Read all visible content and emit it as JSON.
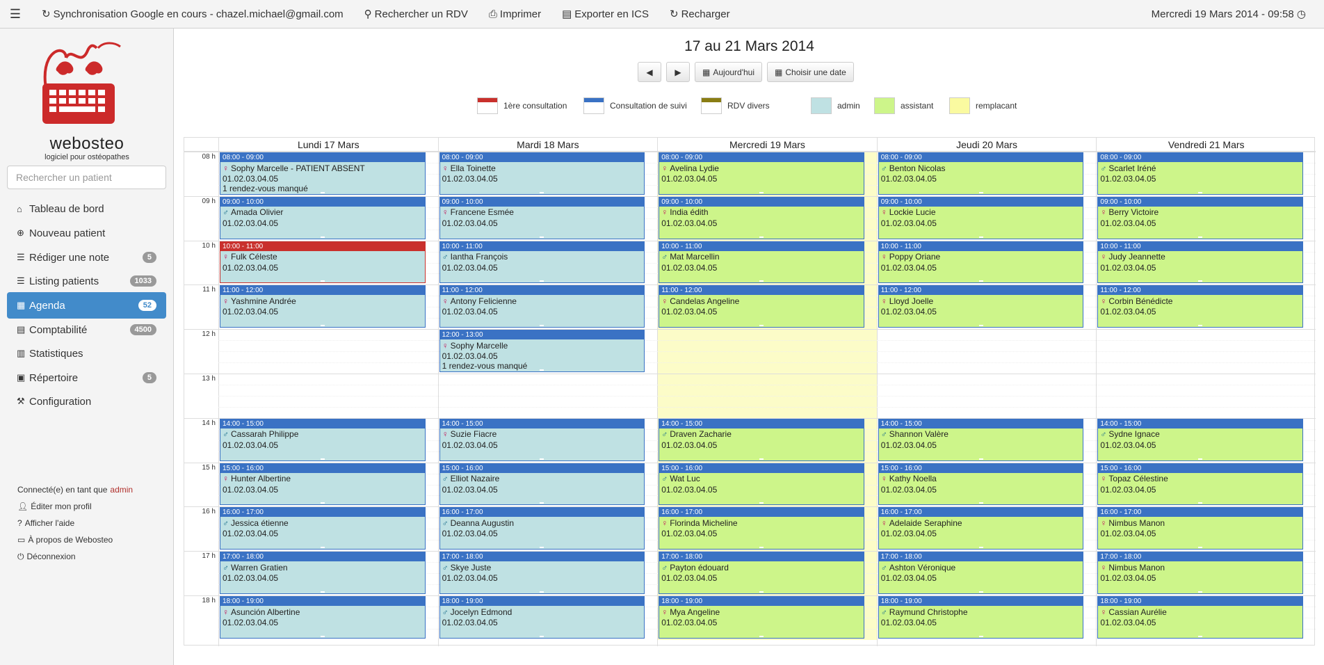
{
  "topbar": {
    "sync_text": "Synchronisation Google en cours - chazel.michael@gmail.com",
    "search_rdv": "Rechercher un RDV",
    "print": "Imprimer",
    "export": "Exporter en ICS",
    "reload": "Recharger",
    "datetime": "Mercredi 19 Mars 2014 - 09:58"
  },
  "logo": {
    "brand": "webosteo",
    "tagline": "logiciel pour ostéopathes"
  },
  "sidebar": {
    "search_placeholder": "Rechercher un patient",
    "items": [
      {
        "label": "Tableau de bord",
        "icon": "home-icon",
        "badge": ""
      },
      {
        "label": "Nouveau patient",
        "icon": "plus-circle-icon",
        "badge": ""
      },
      {
        "label": "Rédiger une note",
        "icon": "list-icon",
        "badge": "5"
      },
      {
        "label": "Listing patients",
        "icon": "list-icon",
        "badge": "1033"
      },
      {
        "label": "Agenda",
        "icon": "calendar-icon",
        "badge": "52",
        "active": true
      },
      {
        "label": "Comptabilité",
        "icon": "calculator-icon",
        "badge": "4500"
      },
      {
        "label": "Statistiques",
        "icon": "bar-chart-icon",
        "badge": ""
      },
      {
        "label": "Répertoire",
        "icon": "book-icon",
        "badge": "5"
      },
      {
        "label": "Configuration",
        "icon": "wrench-icon",
        "badge": ""
      }
    ],
    "connected_as": "Connecté(e) en tant que",
    "username": "admin",
    "links": [
      "Éditer mon profil",
      "Afficher l'aide",
      "À propos de Webosteo",
      "Déconnexion"
    ]
  },
  "main": {
    "week_title": "17 au 21 Mars 2014",
    "today_label": "Aujourd'hui",
    "choose_date_label": "Choisir une date",
    "legend": [
      {
        "label": "1ère consultation",
        "color": "#c9302c",
        "type": "stripe"
      },
      {
        "label": "Consultation de suivi",
        "color": "#3a72c4",
        "type": "stripe"
      },
      {
        "label": "RDV divers",
        "color": "#8a7d14",
        "type": "stripe"
      },
      {
        "label": "admin",
        "color": "#bfe1e3",
        "type": "fill"
      },
      {
        "label": "assistant",
        "color": "#cdf58a",
        "type": "fill"
      },
      {
        "label": "remplacant",
        "color": "#fafaa0",
        "type": "fill"
      }
    ]
  },
  "calendar": {
    "days": [
      "Lundi 17 Mars",
      "Mardi 18 Mars",
      "Mercredi 19 Mars",
      "Jeudi 20 Mars",
      "Vendredi 21 Mars"
    ],
    "hours": [
      "08 h",
      "09 h",
      "10 h",
      "11 h",
      "12 h",
      "13 h",
      "14 h",
      "15 h",
      "16 h",
      "17 h",
      "18 h"
    ],
    "colors": {
      "header_consult": "#3a72c4",
      "header_first": "#c9302c",
      "bg_admin": "#bfe1e3",
      "bg_assistant": "#cdf58a",
      "today_bg": "#fcfcc8"
    },
    "events": [
      {
        "day": 0,
        "start": 8,
        "time": "08:00 - 09:00",
        "name": "Sophy Marcelle - PATIENT ABSENT",
        "sex": "f",
        "phone": "01.02.03.04.05",
        "extra": "1 rendez-vous manqué",
        "kind": "consult",
        "bg": "admin"
      },
      {
        "day": 0,
        "start": 9,
        "time": "09:00 - 10:00",
        "name": "Amada Olivier",
        "sex": "m",
        "phone": "01.02.03.04.05",
        "kind": "consult",
        "bg": "admin"
      },
      {
        "day": 0,
        "start": 10,
        "time": "10:00 - 11:00",
        "name": "Fulk Céleste",
        "sex": "f",
        "phone": "01.02.03.04.05",
        "kind": "first",
        "bg": "admin"
      },
      {
        "day": 0,
        "start": 11,
        "time": "11:00 - 12:00",
        "name": "Yashmine Andrée",
        "sex": "f",
        "phone": "01.02.03.04.05",
        "kind": "consult",
        "bg": "admin"
      },
      {
        "day": 0,
        "start": 14,
        "time": "14:00 - 15:00",
        "name": "Cassarah Philippe",
        "sex": "m",
        "phone": "01.02.03.04.05",
        "kind": "consult",
        "bg": "admin"
      },
      {
        "day": 0,
        "start": 15,
        "time": "15:00 - 16:00",
        "name": "Hunter Albertine",
        "sex": "f",
        "phone": "01.02.03.04.05",
        "kind": "consult",
        "bg": "admin"
      },
      {
        "day": 0,
        "start": 16,
        "time": "16:00 - 17:00",
        "name": "Jessica étienne",
        "sex": "m",
        "phone": "01.02.03.04.05",
        "kind": "consult",
        "bg": "admin"
      },
      {
        "day": 0,
        "start": 17,
        "time": "17:00 - 18:00",
        "name": "Warren Gratien",
        "sex": "m",
        "phone": "01.02.03.04.05",
        "kind": "consult",
        "bg": "admin"
      },
      {
        "day": 0,
        "start": 18,
        "time": "18:00 - 19:00",
        "name": "Asunción Albertine",
        "sex": "f",
        "phone": "01.02.03.04.05",
        "kind": "consult",
        "bg": "admin"
      },
      {
        "day": 1,
        "start": 8,
        "time": "08:00 - 09:00",
        "name": "Ella Toinette",
        "sex": "f",
        "phone": "01.02.03.04.05",
        "kind": "consult",
        "bg": "admin"
      },
      {
        "day": 1,
        "start": 9,
        "time": "09:00 - 10:00",
        "name": "Francene Esmée",
        "sex": "f",
        "phone": "01.02.03.04.05",
        "kind": "consult",
        "bg": "admin"
      },
      {
        "day": 1,
        "start": 10,
        "time": "10:00 - 11:00",
        "name": "Iantha François",
        "sex": "m",
        "phone": "01.02.03.04.05",
        "kind": "consult",
        "bg": "admin"
      },
      {
        "day": 1,
        "start": 11,
        "time": "11:00 - 12:00",
        "name": "Antony Felicienne",
        "sex": "f",
        "phone": "01.02.03.04.05",
        "kind": "consult",
        "bg": "admin"
      },
      {
        "day": 1,
        "start": 12,
        "time": "12:00 - 13:00",
        "name": "Sophy Marcelle",
        "sex": "f",
        "phone": "01.02.03.04.05",
        "extra": "1 rendez-vous manqué",
        "kind": "consult",
        "bg": "admin"
      },
      {
        "day": 1,
        "start": 14,
        "time": "14:00 - 15:00",
        "name": "Suzie Fiacre",
        "sex": "f",
        "phone": "01.02.03.04.05",
        "kind": "consult",
        "bg": "admin"
      },
      {
        "day": 1,
        "start": 15,
        "time": "15:00 - 16:00",
        "name": "Elliot Nazaire",
        "sex": "m",
        "phone": "01.02.03.04.05",
        "kind": "consult",
        "bg": "admin"
      },
      {
        "day": 1,
        "start": 16,
        "time": "16:00 - 17:00",
        "name": "Deanna Augustin",
        "sex": "m",
        "phone": "01.02.03.04.05",
        "kind": "consult",
        "bg": "admin"
      },
      {
        "day": 1,
        "start": 17,
        "time": "17:00 - 18:00",
        "name": "Skye Juste",
        "sex": "m",
        "phone": "01.02.03.04.05",
        "kind": "consult",
        "bg": "admin"
      },
      {
        "day": 1,
        "start": 18,
        "time": "18:00 - 19:00",
        "name": "Jocelyn Edmond",
        "sex": "m",
        "phone": "01.02.03.04.05",
        "kind": "consult",
        "bg": "admin"
      },
      {
        "day": 2,
        "start": 8,
        "time": "08:00 - 09:00",
        "name": "Avelina Lydie",
        "sex": "f",
        "phone": "01.02.03.04.05",
        "kind": "consult",
        "bg": "assistant"
      },
      {
        "day": 2,
        "start": 9,
        "time": "09:00 - 10:00",
        "name": "India édith",
        "sex": "f",
        "phone": "01.02.03.04.05",
        "kind": "consult",
        "bg": "assistant"
      },
      {
        "day": 2,
        "start": 10,
        "time": "10:00 - 11:00",
        "name": "Mat Marcellin",
        "sex": "m",
        "phone": "01.02.03.04.05",
        "kind": "consult",
        "bg": "assistant"
      },
      {
        "day": 2,
        "start": 11,
        "time": "11:00 - 12:00",
        "name": "Candelas Angeline",
        "sex": "f",
        "phone": "01.02.03.04.05",
        "kind": "consult",
        "bg": "assistant"
      },
      {
        "day": 2,
        "start": 14,
        "time": "14:00 - 15:00",
        "name": "Draven Zacharie",
        "sex": "m",
        "phone": "01.02.03.04.05",
        "kind": "consult",
        "bg": "assistant"
      },
      {
        "day": 2,
        "start": 15,
        "time": "15:00 - 16:00",
        "name": "Wat Luc",
        "sex": "m",
        "phone": "01.02.03.04.05",
        "kind": "consult",
        "bg": "assistant"
      },
      {
        "day": 2,
        "start": 16,
        "time": "16:00 - 17:00",
        "name": "Florinda Micheline",
        "sex": "f",
        "phone": "01.02.03.04.05",
        "kind": "consult",
        "bg": "assistant"
      },
      {
        "day": 2,
        "start": 17,
        "time": "17:00 - 18:00",
        "name": "Payton édouard",
        "sex": "m",
        "phone": "01.02.03.04.05",
        "kind": "consult",
        "bg": "assistant"
      },
      {
        "day": 2,
        "start": 18,
        "time": "18:00 - 19:00",
        "name": "Mya Angeline",
        "sex": "f",
        "phone": "01.02.03.04.05",
        "kind": "consult",
        "bg": "assistant"
      },
      {
        "day": 3,
        "start": 8,
        "time": "08:00 - 09:00",
        "name": "Benton Nicolas",
        "sex": "m",
        "phone": "01.02.03.04.05",
        "kind": "consult",
        "bg": "assistant"
      },
      {
        "day": 3,
        "start": 9,
        "time": "09:00 - 10:00",
        "name": "Lockie Lucie",
        "sex": "f",
        "phone": "01.02.03.04.05",
        "kind": "consult",
        "bg": "assistant"
      },
      {
        "day": 3,
        "start": 10,
        "time": "10:00 - 11:00",
        "name": "Poppy Oriane",
        "sex": "f",
        "phone": "01.02.03.04.05",
        "kind": "consult",
        "bg": "assistant"
      },
      {
        "day": 3,
        "start": 11,
        "time": "11:00 - 12:00",
        "name": "Lloyd Joelle",
        "sex": "f",
        "phone": "01.02.03.04.05",
        "kind": "consult",
        "bg": "assistant"
      },
      {
        "day": 3,
        "start": 14,
        "time": "14:00 - 15:00",
        "name": "Shannon Valère",
        "sex": "m",
        "phone": "01.02.03.04.05",
        "kind": "consult",
        "bg": "assistant"
      },
      {
        "day": 3,
        "start": 15,
        "time": "15:00 - 16:00",
        "name": "Kathy Noella",
        "sex": "f",
        "phone": "01.02.03.04.05",
        "kind": "consult",
        "bg": "assistant"
      },
      {
        "day": 3,
        "start": 16,
        "time": "16:00 - 17:00",
        "name": "Adelaide Seraphine",
        "sex": "f",
        "phone": "01.02.03.04.05",
        "kind": "consult",
        "bg": "assistant"
      },
      {
        "day": 3,
        "start": 17,
        "time": "17:00 - 18:00",
        "name": "Ashton Véronique",
        "sex": "m",
        "phone": "01.02.03.04.05",
        "kind": "consult",
        "bg": "assistant"
      },
      {
        "day": 3,
        "start": 18,
        "time": "18:00 - 19:00",
        "name": "Raymund Christophe",
        "sex": "m",
        "phone": "01.02.03.04.05",
        "kind": "consult",
        "bg": "assistant"
      },
      {
        "day": 4,
        "start": 8,
        "time": "08:00 - 09:00",
        "name": "Scarlet Iréné",
        "sex": "m",
        "phone": "01.02.03.04.05",
        "kind": "consult",
        "bg": "assistant"
      },
      {
        "day": 4,
        "start": 9,
        "time": "09:00 - 10:00",
        "name": "Berry Victoire",
        "sex": "f",
        "phone": "01.02.03.04.05",
        "kind": "consult",
        "bg": "assistant"
      },
      {
        "day": 4,
        "start": 10,
        "time": "10:00 - 11:00",
        "name": "Judy Jeannette",
        "sex": "f",
        "phone": "01.02.03.04.05",
        "kind": "consult",
        "bg": "assistant"
      },
      {
        "day": 4,
        "start": 11,
        "time": "11:00 - 12:00",
        "name": "Corbin Bénédicte",
        "sex": "f",
        "phone": "01.02.03.04.05",
        "kind": "consult",
        "bg": "assistant"
      },
      {
        "day": 4,
        "start": 14,
        "time": "14:00 - 15:00",
        "name": "Sydne Ignace",
        "sex": "m",
        "phone": "01.02.03.04.05",
        "kind": "consult",
        "bg": "assistant"
      },
      {
        "day": 4,
        "start": 15,
        "time": "15:00 - 16:00",
        "name": "Topaz Célestine",
        "sex": "f",
        "phone": "01.02.03.04.05",
        "kind": "consult",
        "bg": "assistant"
      },
      {
        "day": 4,
        "start": 16,
        "time": "16:00 - 17:00",
        "name": "Nimbus Manon",
        "sex": "f",
        "phone": "01.02.03.04.05",
        "kind": "consult",
        "bg": "assistant"
      },
      {
        "day": 4,
        "start": 17,
        "time": "17:00 - 18:00",
        "name": "Nimbus Manon",
        "sex": "f",
        "phone": "01.02.03.04.05",
        "kind": "consult",
        "bg": "assistant"
      },
      {
        "day": 4,
        "start": 18,
        "time": "18:00 - 19:00",
        "name": "Cassian Aurélie",
        "sex": "f",
        "phone": "01.02.03.04.05",
        "kind": "consult",
        "bg": "assistant"
      }
    ]
  }
}
